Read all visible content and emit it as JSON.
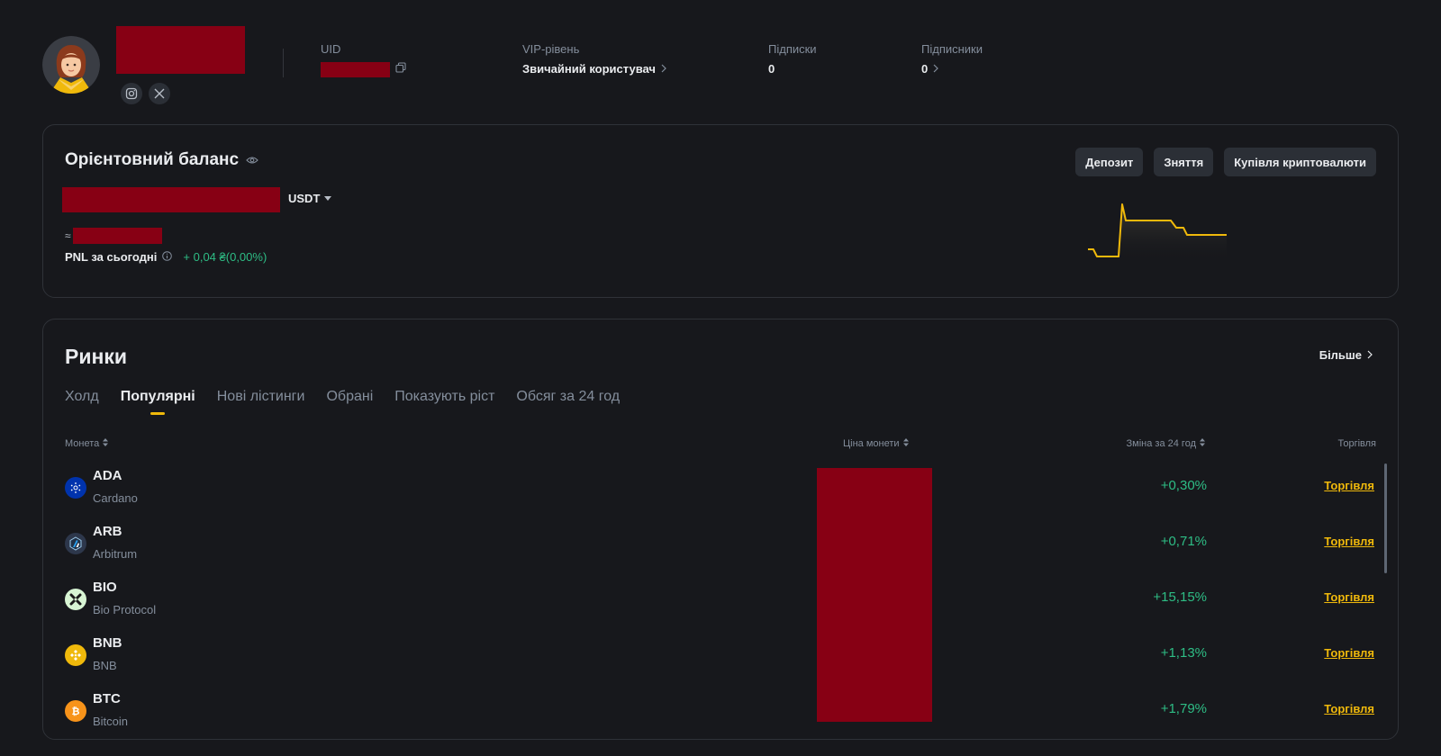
{
  "profile": {
    "social": [
      "instagram-icon",
      "x-icon"
    ],
    "uid_label": "UID",
    "vip_label": "VIP-рівень",
    "vip_value": "Звичайний користувач",
    "following_label": "Підписки",
    "following_value": "0",
    "followers_label": "Підписники",
    "followers_value": "0"
  },
  "balance": {
    "title": "Орієнтовний баланс",
    "currency": "USDT",
    "approx_prefix": "≈",
    "pnl_label": "PNL за сьогодні",
    "pnl_value": "+ 0,04 ₴(0,00%)",
    "actions": {
      "deposit": "Депозит",
      "withdraw": "Зняття",
      "buy": "Купівля криптовалюти"
    }
  },
  "markets": {
    "title": "Ринки",
    "more": "Більше",
    "tabs": [
      "Холд",
      "Популярні",
      "Нові лістинги",
      "Обрані",
      "Показують ріст",
      "Обсяг за 24 год"
    ],
    "active_tab": "Популярні",
    "columns": {
      "coin": "Монета",
      "price": "Ціна монети",
      "change": "Зміна за 24 год",
      "trade": "Торгівля"
    },
    "rows": [
      {
        "symbol": "ADA",
        "name": "Cardano",
        "change": "+0,30%",
        "trade": "Торгівля",
        "icon": "cardano-icon"
      },
      {
        "symbol": "ARB",
        "name": "Arbitrum",
        "change": "+0,71%",
        "trade": "Торгівля",
        "icon": "arbitrum-icon"
      },
      {
        "symbol": "BIO",
        "name": "Bio Protocol",
        "change": "+15,15%",
        "trade": "Торгівля",
        "icon": "bio-protocol-icon"
      },
      {
        "symbol": "BNB",
        "name": "BNB",
        "change": "+1,13%",
        "trade": "Торгівля",
        "icon": "bnb-icon"
      },
      {
        "symbol": "BTC",
        "name": "Bitcoin",
        "change": "+1,79%",
        "trade": "Торгівля",
        "icon": "bitcoin-icon"
      }
    ]
  },
  "colors": {
    "positive": "#2ebd85",
    "accent": "#f0b90b",
    "redaction": "#870014"
  }
}
